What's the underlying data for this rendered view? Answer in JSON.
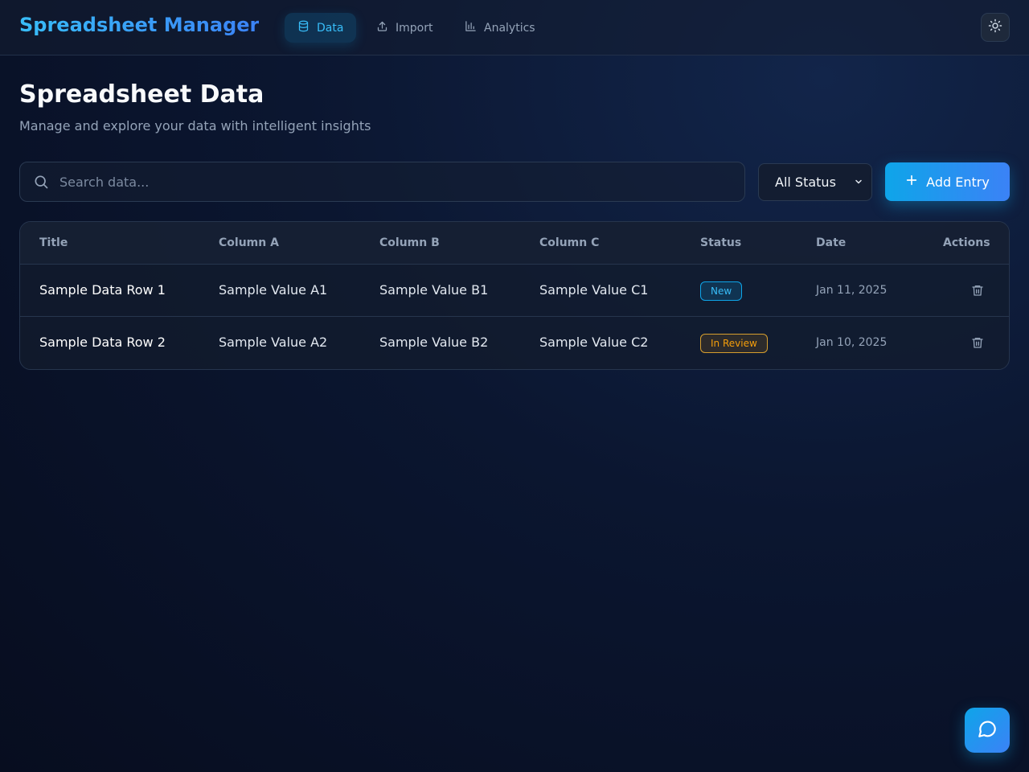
{
  "app": {
    "title": "Spreadsheet Manager"
  },
  "nav": {
    "tabs": [
      {
        "label": "Data",
        "icon": "database-icon",
        "active": true
      },
      {
        "label": "Import",
        "icon": "upload-icon",
        "active": false
      },
      {
        "label": "Analytics",
        "icon": "bar-chart-icon",
        "active": false
      }
    ],
    "theme_toggle_icon": "sun-icon"
  },
  "page": {
    "title": "Spreadsheet Data",
    "subtitle": "Manage and explore your data with intelligent insights"
  },
  "toolbar": {
    "search_placeholder": "Search data...",
    "status_filter": "All Status",
    "add_label": "Add Entry"
  },
  "table": {
    "headers": [
      "Title",
      "Column A",
      "Column B",
      "Column C",
      "Status",
      "Date",
      "Actions"
    ],
    "rows": [
      {
        "title": "Sample Data Row 1",
        "a": "Sample Value A1",
        "b": "Sample Value B1",
        "c": "Sample Value C1",
        "status": "New",
        "date": "Jan 11, 2025"
      },
      {
        "title": "Sample Data Row 2",
        "a": "Sample Value A2",
        "b": "Sample Value B2",
        "c": "Sample Value C2",
        "status": "In Review",
        "date": "Jan 10, 2025"
      }
    ]
  },
  "colors": {
    "accent": "#0ea5e9",
    "accent_secondary": "#3b82f6",
    "status_new": "#38bdf8",
    "status_review": "#f59e0b",
    "background": "#0b1630"
  },
  "fab": {
    "icon": "chat-icon"
  }
}
